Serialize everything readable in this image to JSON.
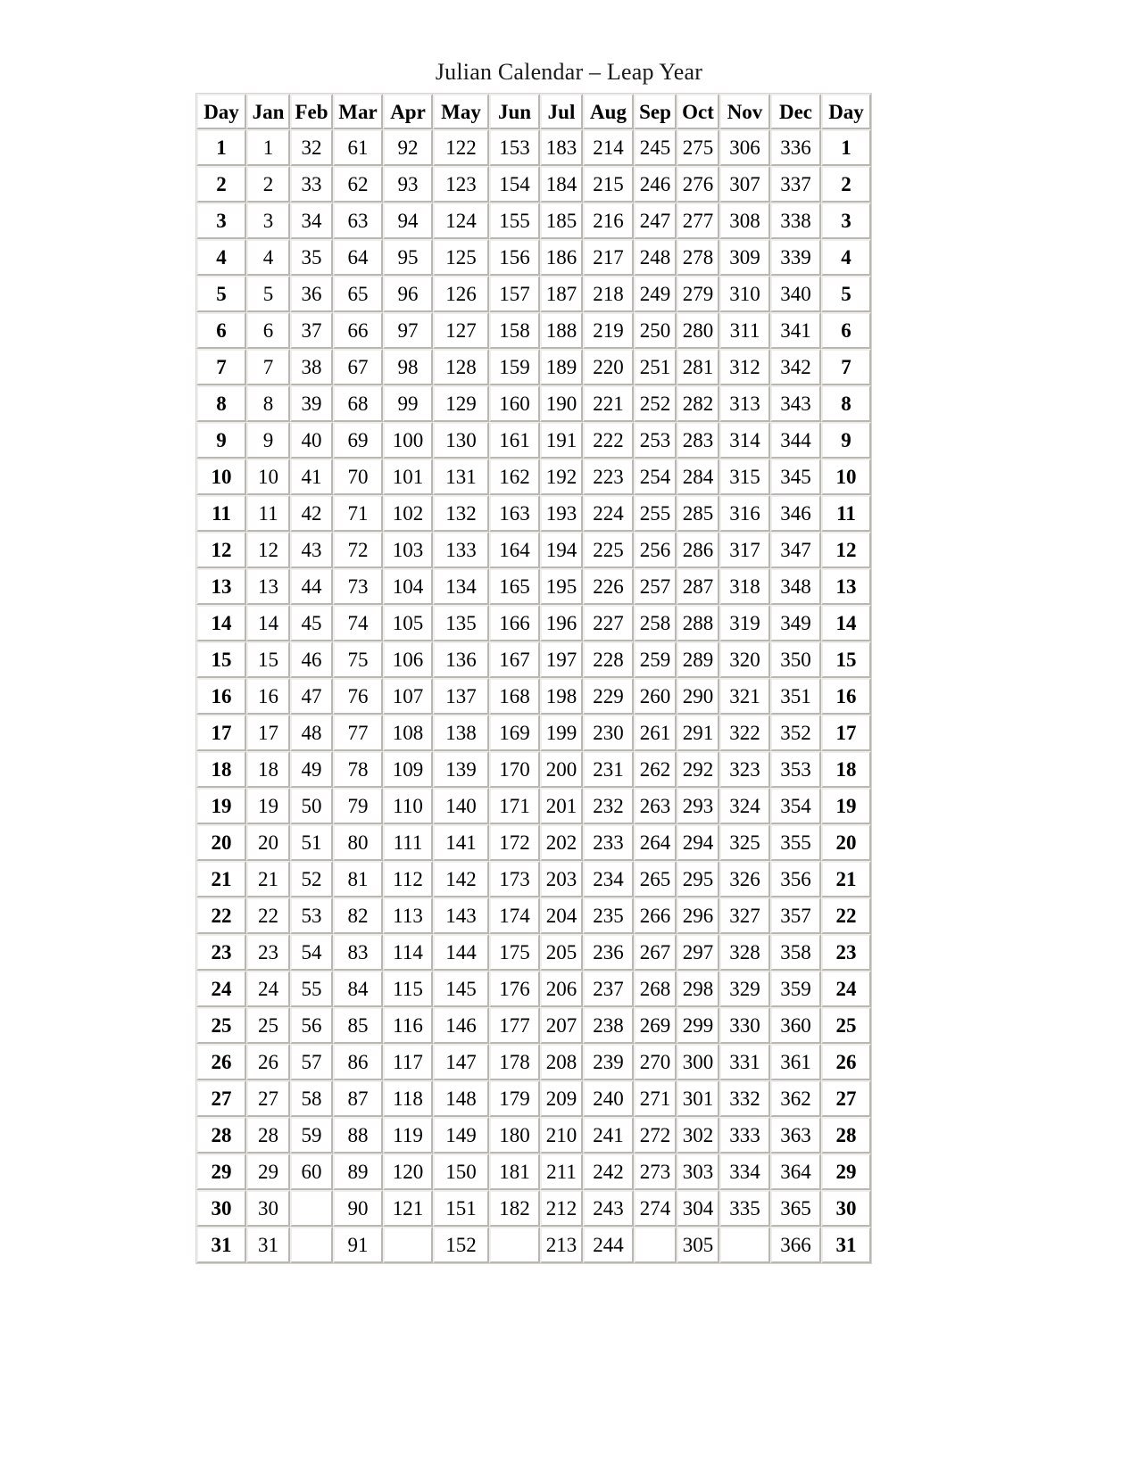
{
  "document": {
    "title": "Julian Calendar – Leap Year"
  },
  "table": {
    "headers": [
      "Day",
      "Jan",
      "Feb",
      "Mar",
      "Apr",
      "May",
      "Jun",
      "Jul",
      "Aug",
      "Sep",
      "Oct",
      "Nov",
      "Dec",
      "Day"
    ],
    "rows": [
      [
        "1",
        "1",
        "32",
        "61",
        "92",
        "122",
        "153",
        "183",
        "214",
        "245",
        "275",
        "306",
        "336",
        "1"
      ],
      [
        "2",
        "2",
        "33",
        "62",
        "93",
        "123",
        "154",
        "184",
        "215",
        "246",
        "276",
        "307",
        "337",
        "2"
      ],
      [
        "3",
        "3",
        "34",
        "63",
        "94",
        "124",
        "155",
        "185",
        "216",
        "247",
        "277",
        "308",
        "338",
        "3"
      ],
      [
        "4",
        "4",
        "35",
        "64",
        "95",
        "125",
        "156",
        "186",
        "217",
        "248",
        "278",
        "309",
        "339",
        "4"
      ],
      [
        "5",
        "5",
        "36",
        "65",
        "96",
        "126",
        "157",
        "187",
        "218",
        "249",
        "279",
        "310",
        "340",
        "5"
      ],
      [
        "6",
        "6",
        "37",
        "66",
        "97",
        "127",
        "158",
        "188",
        "219",
        "250",
        "280",
        "311",
        "341",
        "6"
      ],
      [
        "7",
        "7",
        "38",
        "67",
        "98",
        "128",
        "159",
        "189",
        "220",
        "251",
        "281",
        "312",
        "342",
        "7"
      ],
      [
        "8",
        "8",
        "39",
        "68",
        "99",
        "129",
        "160",
        "190",
        "221",
        "252",
        "282",
        "313",
        "343",
        "8"
      ],
      [
        "9",
        "9",
        "40",
        "69",
        "100",
        "130",
        "161",
        "191",
        "222",
        "253",
        "283",
        "314",
        "344",
        "9"
      ],
      [
        "10",
        "10",
        "41",
        "70",
        "101",
        "131",
        "162",
        "192",
        "223",
        "254",
        "284",
        "315",
        "345",
        "10"
      ],
      [
        "11",
        "11",
        "42",
        "71",
        "102",
        "132",
        "163",
        "193",
        "224",
        "255",
        "285",
        "316",
        "346",
        "11"
      ],
      [
        "12",
        "12",
        "43",
        "72",
        "103",
        "133",
        "164",
        "194",
        "225",
        "256",
        "286",
        "317",
        "347",
        "12"
      ],
      [
        "13",
        "13",
        "44",
        "73",
        "104",
        "134",
        "165",
        "195",
        "226",
        "257",
        "287",
        "318",
        "348",
        "13"
      ],
      [
        "14",
        "14",
        "45",
        "74",
        "105",
        "135",
        "166",
        "196",
        "227",
        "258",
        "288",
        "319",
        "349",
        "14"
      ],
      [
        "15",
        "15",
        "46",
        "75",
        "106",
        "136",
        "167",
        "197",
        "228",
        "259",
        "289",
        "320",
        "350",
        "15"
      ],
      [
        "16",
        "16",
        "47",
        "76",
        "107",
        "137",
        "168",
        "198",
        "229",
        "260",
        "290",
        "321",
        "351",
        "16"
      ],
      [
        "17",
        "17",
        "48",
        "77",
        "108",
        "138",
        "169",
        "199",
        "230",
        "261",
        "291",
        "322",
        "352",
        "17"
      ],
      [
        "18",
        "18",
        "49",
        "78",
        "109",
        "139",
        "170",
        "200",
        "231",
        "262",
        "292",
        "323",
        "353",
        "18"
      ],
      [
        "19",
        "19",
        "50",
        "79",
        "110",
        "140",
        "171",
        "201",
        "232",
        "263",
        "293",
        "324",
        "354",
        "19"
      ],
      [
        "20",
        "20",
        "51",
        "80",
        "111",
        "141",
        "172",
        "202",
        "233",
        "264",
        "294",
        "325",
        "355",
        "20"
      ],
      [
        "21",
        "21",
        "52",
        "81",
        "112",
        "142",
        "173",
        "203",
        "234",
        "265",
        "295",
        "326",
        "356",
        "21"
      ],
      [
        "22",
        "22",
        "53",
        "82",
        "113",
        "143",
        "174",
        "204",
        "235",
        "266",
        "296",
        "327",
        "357",
        "22"
      ],
      [
        "23",
        "23",
        "54",
        "83",
        "114",
        "144",
        "175",
        "205",
        "236",
        "267",
        "297",
        "328",
        "358",
        "23"
      ],
      [
        "24",
        "24",
        "55",
        "84",
        "115",
        "145",
        "176",
        "206",
        "237",
        "268",
        "298",
        "329",
        "359",
        "24"
      ],
      [
        "25",
        "25",
        "56",
        "85",
        "116",
        "146",
        "177",
        "207",
        "238",
        "269",
        "299",
        "330",
        "360",
        "25"
      ],
      [
        "26",
        "26",
        "57",
        "86",
        "117",
        "147",
        "178",
        "208",
        "239",
        "270",
        "300",
        "331",
        "361",
        "26"
      ],
      [
        "27",
        "27",
        "58",
        "87",
        "118",
        "148",
        "179",
        "209",
        "240",
        "271",
        "301",
        "332",
        "362",
        "27"
      ],
      [
        "28",
        "28",
        "59",
        "88",
        "119",
        "149",
        "180",
        "210",
        "241",
        "272",
        "302",
        "333",
        "363",
        "28"
      ],
      [
        "29",
        "29",
        "60",
        "89",
        "120",
        "150",
        "181",
        "211",
        "242",
        "273",
        "303",
        "334",
        "364",
        "29"
      ],
      [
        "30",
        "30",
        "",
        "90",
        "121",
        "151",
        "182",
        "212",
        "243",
        "274",
        "304",
        "335",
        "365",
        "30"
      ],
      [
        "31",
        "31",
        "",
        "91",
        "",
        "152",
        "",
        "213",
        "244",
        "",
        "305",
        "",
        "366",
        "31"
      ]
    ]
  },
  "style": {
    "page_background": "#ffffff",
    "text_color": "#000000",
    "cell_border_light": "#efeeec",
    "cell_border_dark": "#b9b7b2",
    "table_outer_border": "#d7d5d0"
  }
}
